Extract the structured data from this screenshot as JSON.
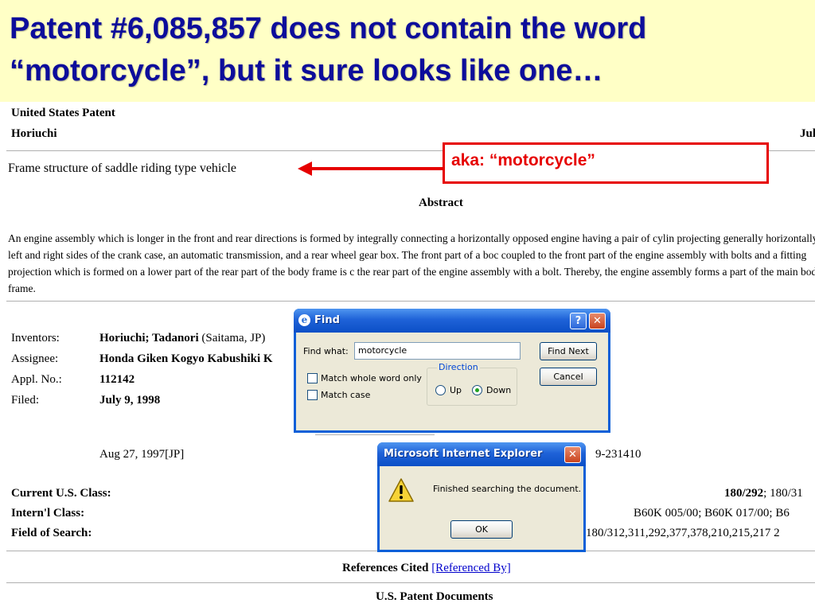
{
  "slide": {
    "title_line1": "Patent #6,085,857 does not contain the word",
    "title_line2": "“motorcycle”, but it sure looks like one…"
  },
  "patent": {
    "source": "United States Patent",
    "inventor_short": "Horiuchi",
    "date_partial": "Jul",
    "title": "Frame structure of saddle riding type vehicle",
    "abstract_heading": "Abstract",
    "abstract_text": "An engine assembly which is longer in the front and rear directions is formed by integrally connecting a horizontally opposed engine having a pair of cylin projecting generally horizontally from left and right sides of the crank case, an automatic transmission, and a rear wheel gear box. The front part of a boc coupled to the front part of the engine assembly with bolts and a fitting projection which is formed on a lower part of the rear part of the body frame is c the rear part of the engine assembly with a bolt. Thereby, the engine assembly forms a part of the main body frame.",
    "fields": [
      {
        "label": "Inventors:",
        "value": "Horiuchi; Tadanori",
        "extra": "(Saitama, JP)"
      },
      {
        "label": "Assignee:",
        "value": "Honda Giken Kogyo Kabushiki K",
        "extra": ""
      },
      {
        "label": "Appl. No.:",
        "value": "112142",
        "extra": ""
      },
      {
        "label": "Filed:",
        "value": "July 9, 1998",
        "extra": ""
      }
    ],
    "priority_date": "Aug 27, 1997[JP]",
    "priority_number": "9-231410",
    "classes": [
      {
        "label": "Current U.S. Class:",
        "value_bold": "180/292",
        "value_rest": "; 180/31"
      },
      {
        "label": "Intern'l Class:",
        "value_bold": "",
        "value_rest": "B60K 005/00; B60K 017/00; B6"
      },
      {
        "label": "Field of Search:",
        "value_bold": "",
        "value_rest": "180/312,311,292,377,378,210,215,217 2"
      }
    ],
    "references_heading": "References Cited",
    "referenced_by_link": "[Referenced By]",
    "us_docs_heading": "U.S. Patent Documents"
  },
  "callout": {
    "text": "aka: “motorcycle”",
    "color": "#e60000"
  },
  "find_dialog": {
    "title": "Find",
    "find_what_label": "Find what:",
    "find_what_value": "motorcycle",
    "find_next_label": "Find Next",
    "cancel_label": "Cancel",
    "match_whole_word_label": "Match whole word only",
    "match_case_label": "Match case",
    "match_whole_word_checked": false,
    "match_case_checked": false,
    "direction_label": "Direction",
    "direction_up_label": "Up",
    "direction_down_label": "Down",
    "direction_selected": "Down",
    "help_glyph": "?",
    "close_glyph": "✕"
  },
  "message_dialog": {
    "title": "Microsoft Internet Explorer",
    "message": "Finished searching the document.",
    "ok_label": "OK",
    "icon": "warning-icon",
    "close_glyph": "✕"
  },
  "colors": {
    "slide_title": "#0d0d9b",
    "header_background": "#ffffc6",
    "link": "#0000cc",
    "xp_titlebar": "#1f62d8"
  }
}
